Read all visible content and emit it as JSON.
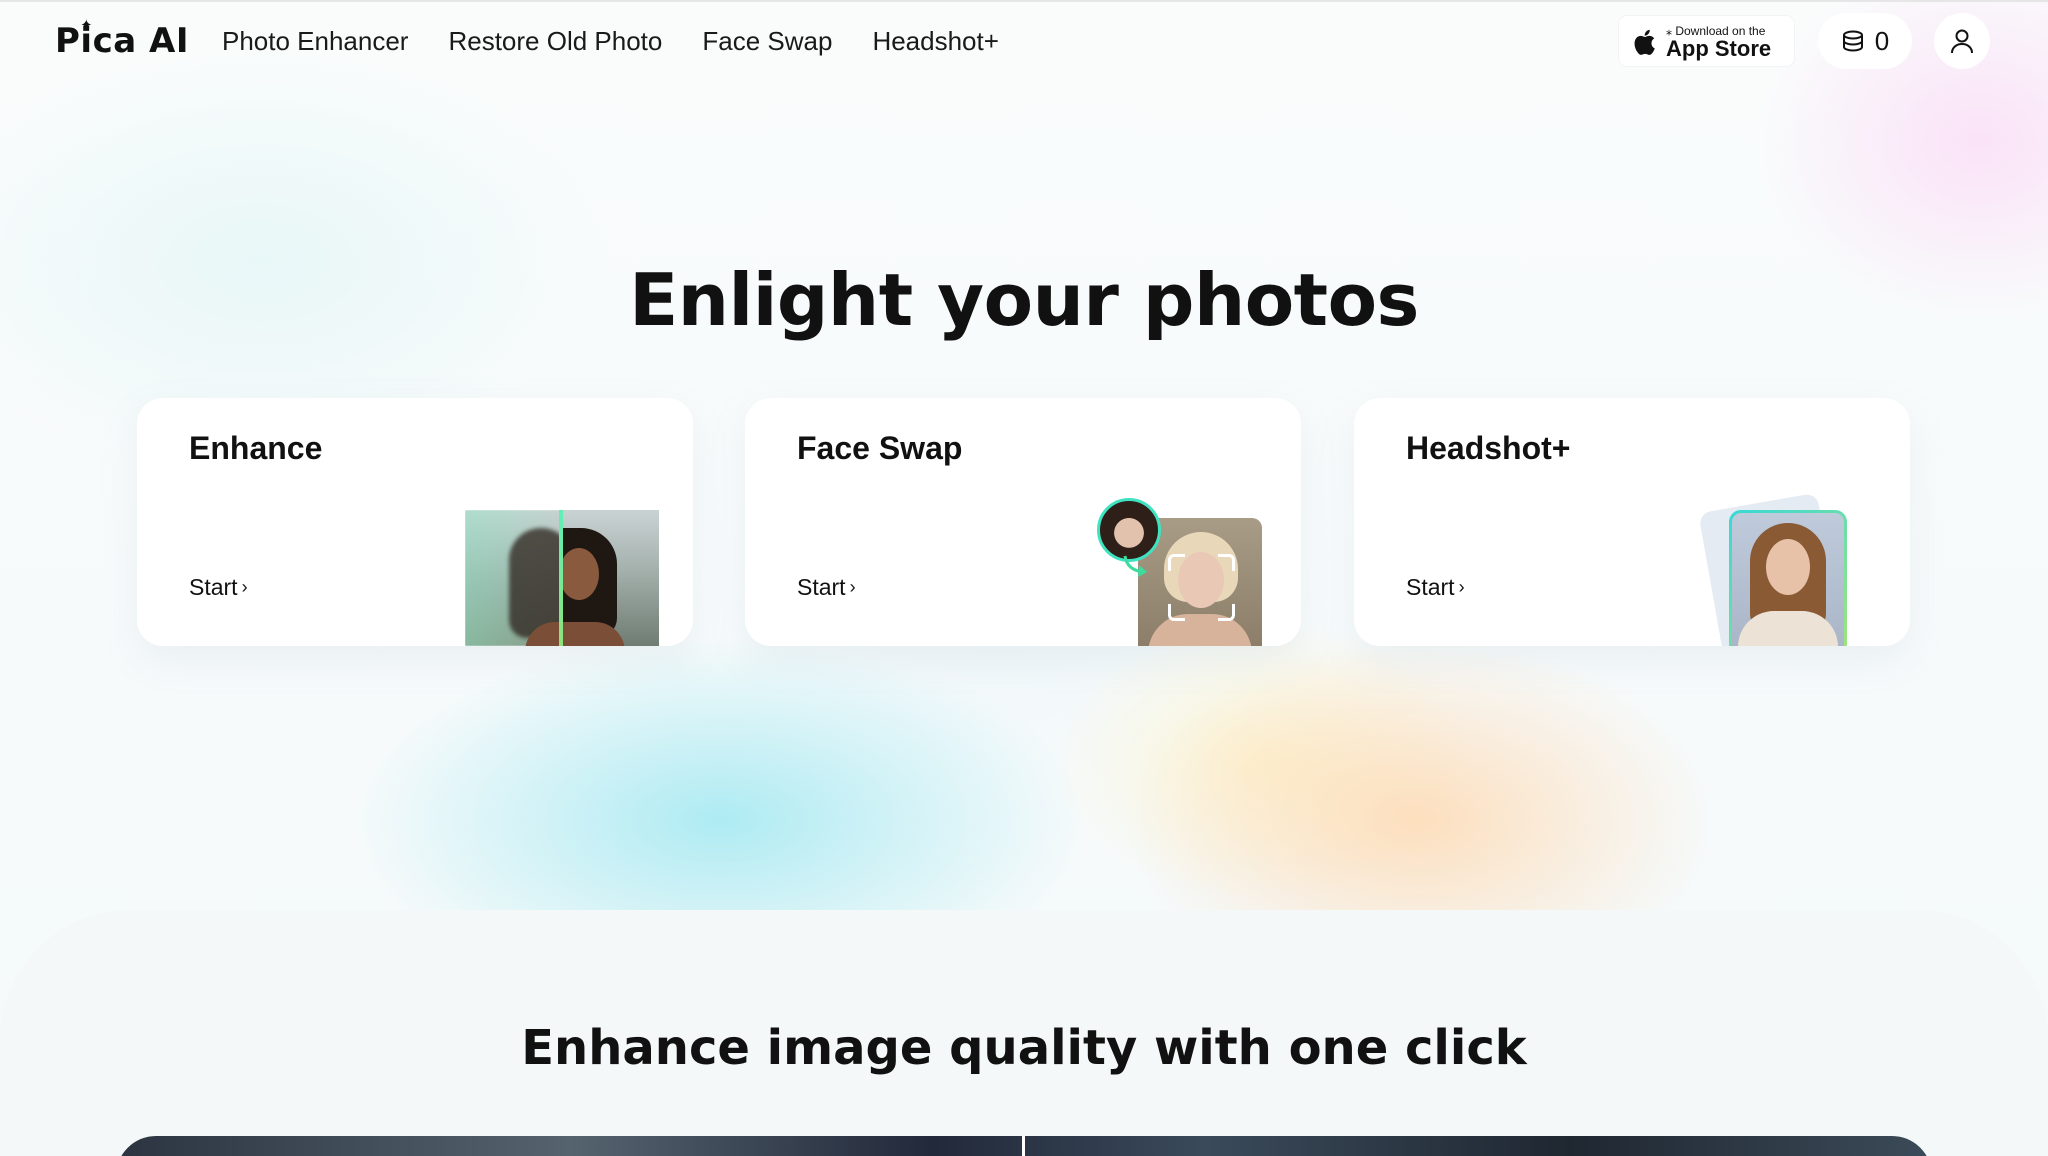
{
  "header": {
    "logo": "Pica AI",
    "nav": [
      "Photo Enhancer",
      "Restore Old Photo",
      "Face Swap",
      "Headshot+"
    ],
    "app_store": {
      "small": "Download on the",
      "big": "App Store"
    },
    "credits": "0"
  },
  "hero": {
    "title": "Enlight your photos",
    "cards": [
      {
        "title": "Enhance",
        "start": "Start"
      },
      {
        "title": "Face Swap",
        "start": "Start"
      },
      {
        "title": "Headshot+",
        "start": "Start"
      }
    ]
  },
  "section": {
    "title": "Enhance image quality with one click"
  },
  "icons": [
    "apple-icon",
    "coins-icon",
    "user-icon",
    "chevron-right-icon"
  ]
}
